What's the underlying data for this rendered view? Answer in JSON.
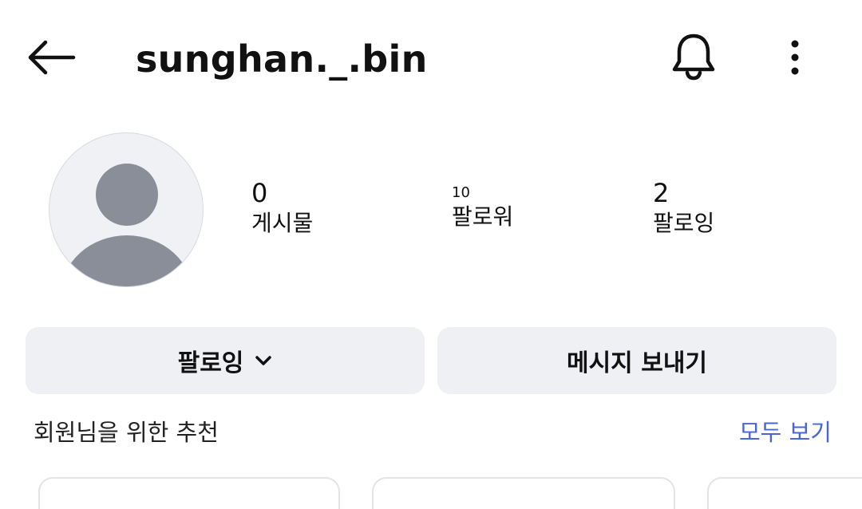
{
  "header": {
    "username": "sunghan._.bin",
    "back_icon": "arrow-left-icon",
    "notification_icon": "bell-icon",
    "more_icon": "more-vertical-icon"
  },
  "profile": {
    "avatar": "default-avatar",
    "stats": {
      "posts": {
        "value": "0",
        "label": "게시물"
      },
      "followers": {
        "value": "10",
        "label": "팔로워"
      },
      "following": {
        "value": "2",
        "label": "팔로잉"
      }
    }
  },
  "actions": {
    "follow_label": "팔로잉",
    "follow_icon": "chevron-down-icon",
    "message_label": "메시지 보내기"
  },
  "suggestions": {
    "title": "회원님을 위한 추천",
    "see_all": "모두 보기"
  },
  "colors": {
    "link": "#4b64d6",
    "button_bg": "#eff0f3",
    "avatar_fill": "#898e98",
    "avatar_bg": "#f0f1f4"
  }
}
